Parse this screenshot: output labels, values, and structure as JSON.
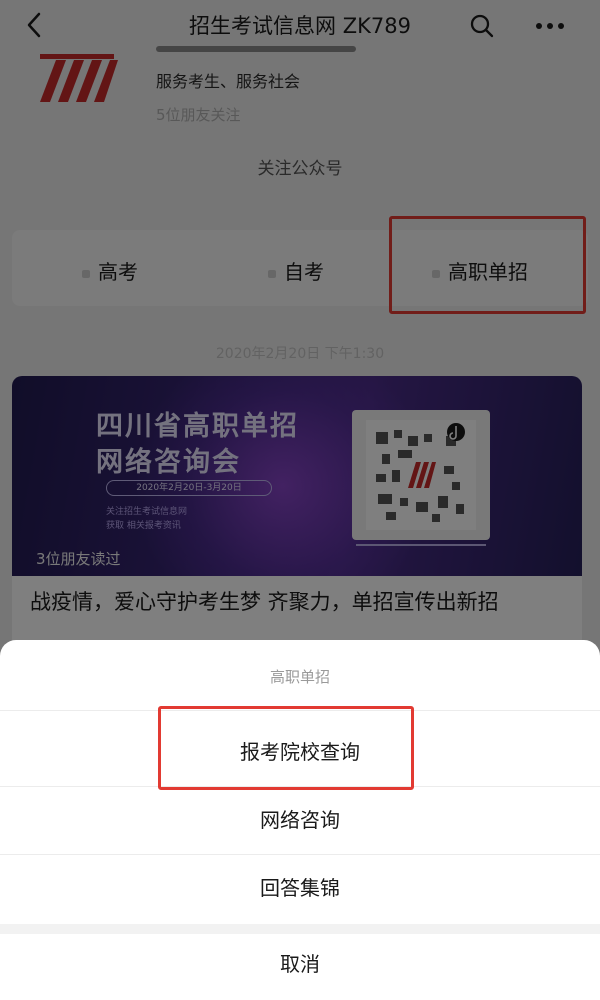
{
  "top_bar": {
    "title": "招生考试信息网 ZK789"
  },
  "profile": {
    "description": "服务考生、服务社会",
    "friends_following": "5位朋友关注",
    "follow_label": "关注公众号"
  },
  "tabs": [
    {
      "label": "高考"
    },
    {
      "label": "自考"
    },
    {
      "label": "高职单招"
    }
  ],
  "post": {
    "date": "2020年2月20日 下午1:30",
    "banner_title_line1": "四川省高职单招",
    "banner_title_line2": "网络咨询会",
    "banner_date": "2020年2月20日-3月20日",
    "banner_sub_line1": "关注招生考试信息网",
    "banner_sub_line2": "获取 相关报考资讯",
    "read_count": "3位朋友读过",
    "title": "战疫情，爱心守护考生梦 齐聚力，单招宣传出新招"
  },
  "action_sheet": {
    "title": "高职单招",
    "items": [
      {
        "label": "报考院校查询"
      },
      {
        "label": "网络咨询"
      },
      {
        "label": "回答集锦"
      }
    ],
    "cancel_label": "取消"
  },
  "colors": {
    "highlight": "#e23a32",
    "brand": "#c62a2a",
    "banner": "#3a2677"
  }
}
